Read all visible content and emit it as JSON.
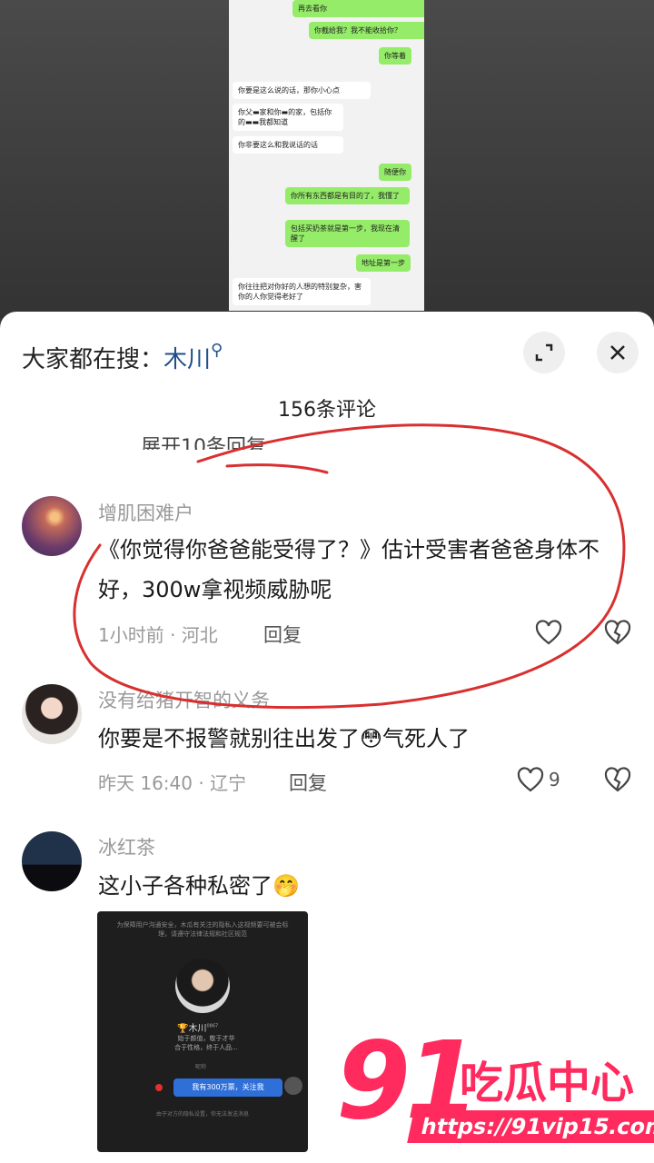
{
  "chat_screenshot": {
    "messages": [
      {
        "side": "me",
        "text": "再去看你"
      },
      {
        "side": "me",
        "text": "你截给我？我不能收拾你？"
      },
      {
        "side": "me",
        "text": "你等着"
      },
      {
        "side": "other",
        "text": "你要是这么说的话，那你小心点"
      },
      {
        "side": "other",
        "text": "你父▬家和你▬的家，包括你的▬▬我都知道"
      },
      {
        "side": "other",
        "text": "你非要这么和我说话的话"
      },
      {
        "side": "me",
        "text": "随便你"
      },
      {
        "side": "me",
        "text": "你所有东西都是有目的了，我懂了"
      },
      {
        "side": "me",
        "text": "包括买奶茶就是第一步，我现在清醒了"
      },
      {
        "side": "me",
        "text": "地址是第一步"
      },
      {
        "side": "other",
        "text": "你往往把对你好的人想的特别复杂，害你的人你觉得老好了"
      }
    ]
  },
  "header": {
    "search_prefix": "大家都在搜：",
    "search_keyword": "木川"
  },
  "comments_count": "156条评论",
  "collapsed_replies": "展开10条回复",
  "comments": [
    {
      "user": "增肌困难户",
      "text": "《你觉得你爸爸能受得了？》估计受害者爸爸身体不好，300w拿视频威胁呢",
      "time_loc": "1小时前 · 河北",
      "reply": "回复",
      "likes": ""
    },
    {
      "user": "没有给猪开智的义务",
      "text": "你要是不报警就别往出发了",
      "emoji": "😳",
      "text_after": "气死人了",
      "time_loc": "昨天 16:40 · 辽宁",
      "reply": "回复",
      "likes": "9"
    },
    {
      "user": "冰红茶",
      "text": "这小子各种私密了",
      "emoji": "🤭"
    }
  ],
  "embedded_image": {
    "notice": "为保障用户沟通安全，木瓜有关注的隐私入这视频要可被会标理，请遵守法律法规和社区规范",
    "name": "木川",
    "id": "0867",
    "bio": "始于颜值，敬于才华\n合于性格，终于人品...",
    "label": "昵称",
    "message": "我有300万票，关注我",
    "footer": "由于对方的隐私设置，你无法发送消息"
  },
  "watermark": {
    "big": "91",
    "title": "吃瓜中心",
    "url": "https://91vip15.com"
  },
  "colors": {
    "accent": "#1f4f8a",
    "circle": "#d83030",
    "brand": "#ff2b5e"
  }
}
